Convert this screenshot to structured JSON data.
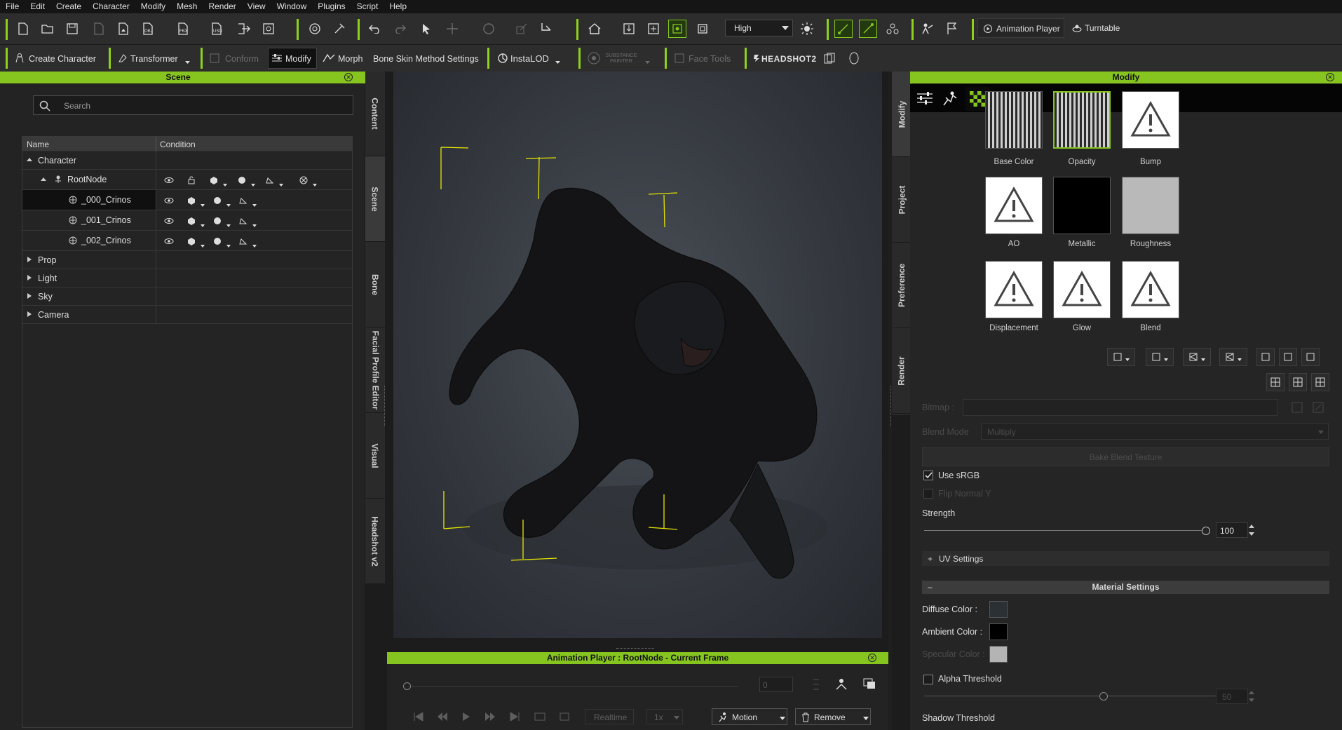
{
  "menu": [
    "File",
    "Edit",
    "Create",
    "Character",
    "Modify",
    "Mesh",
    "Render",
    "View",
    "Window",
    "Plugins",
    "Script",
    "Help"
  ],
  "toolbar1": {
    "quality_select": "High",
    "animation_player": "Animation Player",
    "turntable": "Turntable"
  },
  "toolbar2": {
    "create_character": "Create Character",
    "transformer": "Transformer",
    "conform": "Conform",
    "modify": "Modify",
    "morph": "Morph",
    "bone_skin": "Bone Skin Method Settings",
    "instalod": "InstaLOD",
    "substance": "SUBSTANCE PAINTER",
    "face_tools": "Face Tools",
    "headshot": "HEADSHOT2"
  },
  "scene": {
    "title": "Scene",
    "search_placeholder": "Search",
    "col_name": "Name",
    "col_condition": "Condition",
    "rows": [
      "Character",
      "RootNode",
      "_000_Crinos",
      "_001_Crinos",
      "_002_Crinos",
      "Prop",
      "Light",
      "Sky",
      "Camera"
    ]
  },
  "left_tabs": [
    "Content",
    "Scene",
    "Bone",
    "Facial Profile Editor",
    "Visual",
    "Headshot v2"
  ],
  "right_tabs": [
    "Modify",
    "Project",
    "Preference",
    "Render"
  ],
  "anim": {
    "title": "Animation Player : RootNode - Current Frame",
    "frame": "0",
    "realtime": "Realtime",
    "speed": "1x",
    "motion": "Motion",
    "remove": "Remove"
  },
  "modify": {
    "title": "Modify",
    "textures": [
      "Base Color",
      "Opacity",
      "Bump",
      "AO",
      "Metallic",
      "Roughness",
      "Displacement",
      "Glow",
      "Blend"
    ],
    "bitmap_label": "Bitmap :",
    "blend_mode_label": "Blend Mode",
    "blend_mode_value": "Multiply",
    "bake_blend": "Bake Blend Texture",
    "use_srgb": "Use sRGB",
    "flip_normal": "Flip Normal Y",
    "strength_label": "Strength",
    "strength_value": "100",
    "uv_settings": "UV Settings",
    "uv_sign": "+",
    "material_settings": "Material Settings",
    "material_sign": "–",
    "diffuse": "Diffuse Color :",
    "ambient": "Ambient Color :",
    "specular": "Specular Color :",
    "alpha_threshold": "Alpha Threshold",
    "alpha_value": "50",
    "shadow_threshold": "Shadow Threshold"
  },
  "colors": {
    "accent": "#86c51f",
    "diffuse": "#2b3035",
    "ambient": "#000000",
    "specular": "#b4b4b4",
    "metallic": "#000000",
    "roughness": "#b9b9b9"
  }
}
